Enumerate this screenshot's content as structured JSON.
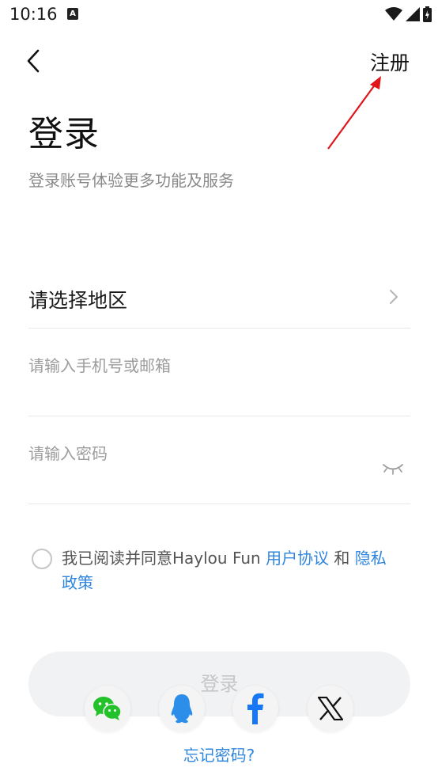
{
  "status_bar": {
    "time": "10:16",
    "notification_glyph": "A"
  },
  "nav": {
    "back_icon": "chevron-left-icon",
    "register_label": "注册"
  },
  "title": "登录",
  "subtitle": "登录账号体验更多功能及服务",
  "form": {
    "region_label": "请选择地区",
    "phone_placeholder": "请输入手机号或邮箱",
    "phone_value": "",
    "password_placeholder": "请输入密码",
    "password_value": ""
  },
  "agreement": {
    "prefix": "我已阅读并同意Haylou Fun ",
    "user_agreement": "用户协议",
    "and": " 和 ",
    "privacy_policy": "隐私政策",
    "checked": false
  },
  "login_button_label": "登录",
  "social_logins": [
    "wechat-icon",
    "qq-icon",
    "facebook-icon",
    "x-icon"
  ],
  "forgot_password_label": "忘记密码?",
  "colors": {
    "link": "#2f86e0",
    "annotation_arrow": "#e0161b",
    "button_disabled_bg": "#f1f2f4",
    "wechat": "#23c22b",
    "qq": "#2d8eea",
    "facebook": "#1877f2"
  }
}
